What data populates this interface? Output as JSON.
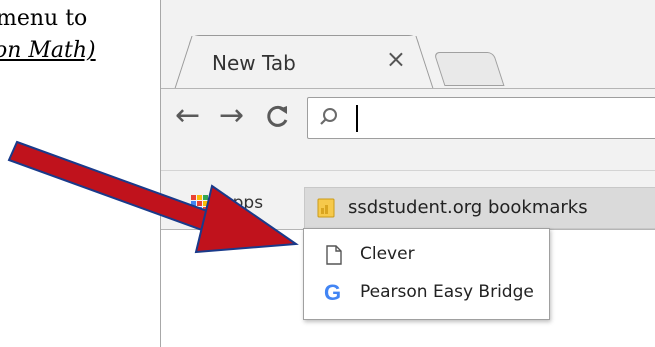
{
  "instruction": {
    "line1": "menu to",
    "line2": "on Math)"
  },
  "browser": {
    "tab": {
      "title": "New Tab",
      "close_glyph": "×"
    },
    "toolbar": {
      "back_glyph": "←",
      "forward_glyph": "→",
      "reload_glyph": "C",
      "omnibox": {
        "value": "",
        "icon": "search-icon"
      }
    },
    "bookmarks_bar": {
      "apps_label": "Apps",
      "folder": {
        "label": "ssdstudent.org bookmarks",
        "icon": "folder-icon"
      },
      "dropdown_items": [
        {
          "label": "Clever",
          "icon": "page-icon"
        },
        {
          "label": "Pearson Easy Bridge",
          "icon": "google-g-icon"
        }
      ]
    }
  },
  "annotation": {
    "color": "#c0121c",
    "outline": "#1a3a8a"
  }
}
